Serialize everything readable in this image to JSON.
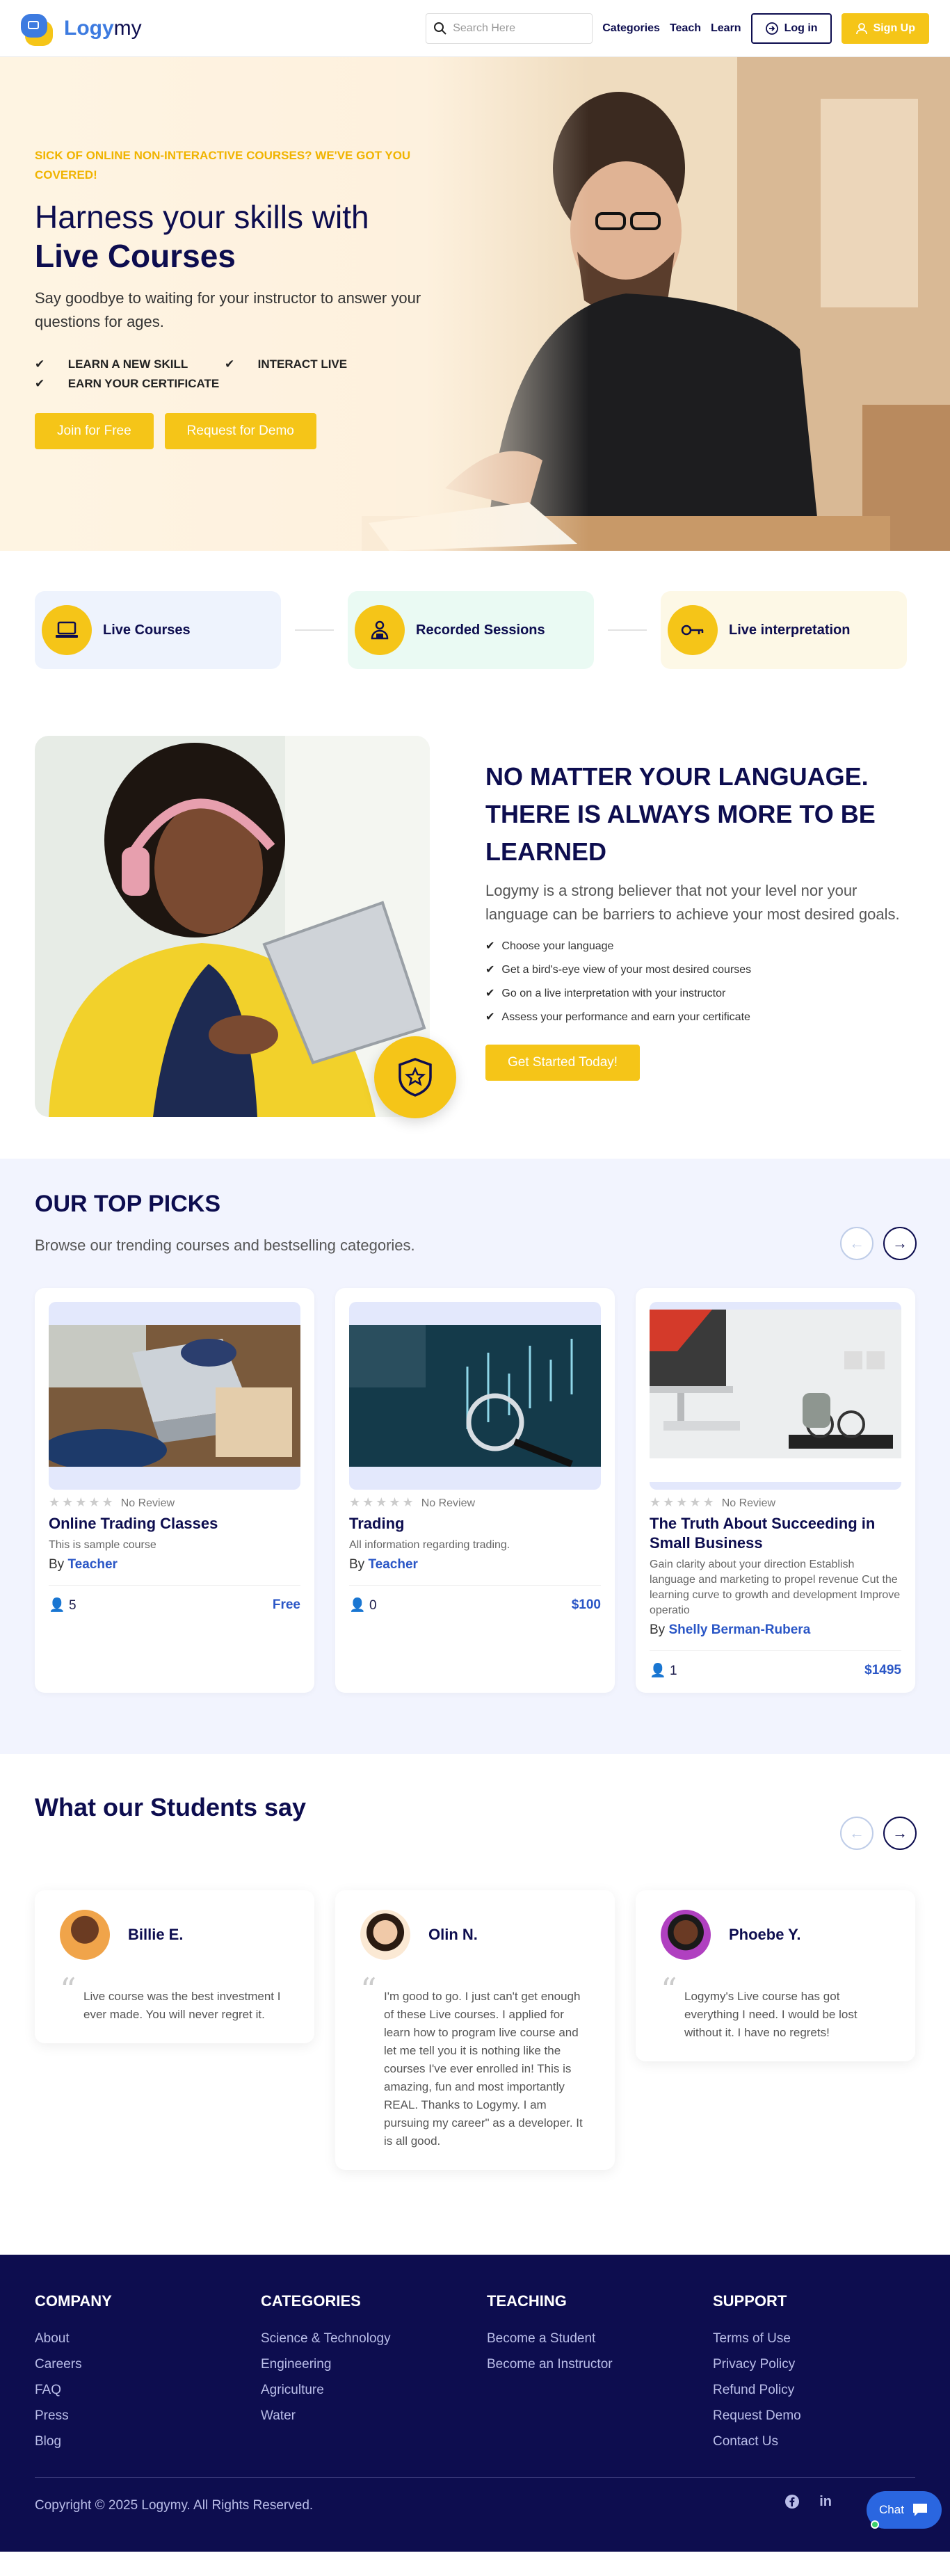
{
  "header": {
    "logo_text_a": "Logy",
    "logo_text_b": "my",
    "search_placeholder": "Search Here",
    "nav": [
      "Categories",
      "Teach",
      "Learn"
    ],
    "login_label": "Log in",
    "signup_label": "Sign Up"
  },
  "hero": {
    "eyebrow": "SICK OF ONLINE NON-INTERACTIVE COURSES? WE'VE GOT YOU COVERED!",
    "title_line1": "Harness your skills with",
    "title_line2": "Live Courses",
    "subtitle": "Say goodbye to waiting for your instructor to answer your questions for ages.",
    "checks": [
      "LEARN A NEW SKILL",
      "INTERACT LIVE",
      "EARN YOUR CERTIFICATE"
    ],
    "btn_join": "Join for Free",
    "btn_demo": "Request for Demo"
  },
  "features": [
    {
      "label": "Live Courses",
      "bg": "#eef3fd",
      "icon": "laptop-icon"
    },
    {
      "label": "Recorded Sessions",
      "bg": "#eafaf3",
      "icon": "presenter-icon"
    },
    {
      "label": "Live interpretation",
      "bg": "#fdf8e6",
      "icon": "interpretation-icon"
    }
  ],
  "language": {
    "heading_line1": "NO MATTER YOUR LANGUAGE.",
    "heading_line2": "THERE IS ALWAYS MORE TO BE LEARNED",
    "paragraph": "Logymy is a strong believer that not your level nor your language can be barriers to achieve your most desired goals.",
    "list": [
      "Choose your language",
      "Get a bird's-eye view of your most desired courses",
      "Go on a live interpretation with your instructor",
      "Assess your performance and earn your certificate"
    ],
    "cta": "Get Started Today!"
  },
  "picks": {
    "title_a": "OUR ",
    "title_b": "TOP PICKS",
    "subtitle": "Browse our trending courses and bestselling categories.",
    "no_review": "No Review",
    "by": "By",
    "courses": [
      {
        "title": "Online Trading Classes",
        "desc": "This is sample course",
        "author": "Teacher",
        "students": "5",
        "price": "Free"
      },
      {
        "title": "Trading",
        "desc": "All information regarding trading.",
        "author": "Teacher",
        "students": "0",
        "price": "$100"
      },
      {
        "title": "The Truth About Succeeding in Small Business",
        "desc": "Gain clarity about your direction Establish language and marketing to propel revenue Cut the learning curve to growth and development Improve operatio",
        "author": "Shelly Berman-Rubera",
        "students": "1",
        "price": "$1495"
      }
    ]
  },
  "testimonials": {
    "title_a": "What our ",
    "title_b": "Students say",
    "items": [
      {
        "name": "Billie E.",
        "quote": "Live course was the best investment I ever made. You will never regret it.",
        "avatar_color": "#f0a44a"
      },
      {
        "name": "Olin N.",
        "quote": "I'm good to go. I just can't get enough of these Live courses. I applied for learn how to program live course and let me tell you it is nothing like the courses I've ever enrolled in! This is amazing, fun and most importantly REAL. Thanks to Logymy. I am pursuing my career\" as a developer. It is all good. ",
        "avatar_color": "#f6c9a0"
      },
      {
        "name": "Phoebe Y.",
        "quote": "Logymy's Live course has got everything I need. I would be lost without it. I have no regrets!",
        "avatar_color": "#b040c0"
      }
    ]
  },
  "footer": {
    "columns": [
      {
        "title": "COMPANY",
        "links": [
          "About",
          "Careers",
          "FAQ",
          "Press",
          "Blog"
        ]
      },
      {
        "title": "CATEGORIES",
        "links": [
          "Science & Technology",
          "Engineering",
          "Agriculture",
          "Water"
        ]
      },
      {
        "title": "TEACHING",
        "links": [
          "Become a Student",
          "Become an Instructor"
        ]
      },
      {
        "title": "SUPPORT",
        "links": [
          "Terms of Use",
          "Privacy Policy",
          "Refund Policy",
          "Request Demo",
          "Contact Us"
        ]
      }
    ],
    "copyright": "Copyright © 2025 Logymy. All Rights Reserved.",
    "social": [
      "facebook-icon",
      "linkedin-icon"
    ],
    "chat_label": "Chat"
  },
  "colors": {
    "accent": "#f5c518",
    "navy": "#0d0d4f",
    "link": "#2a56c6"
  }
}
